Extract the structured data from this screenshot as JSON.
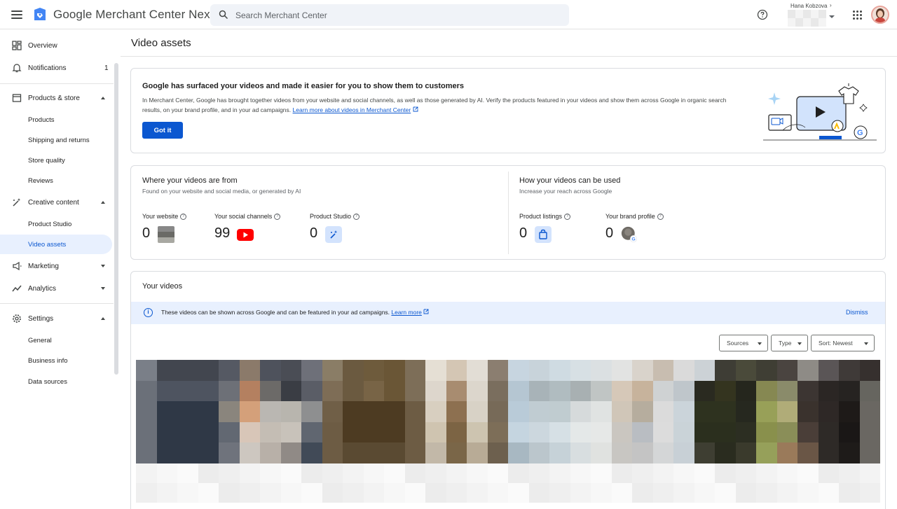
{
  "app": {
    "title": "Google Merchant Center Next"
  },
  "search": {
    "placeholder": "Search Merchant Center"
  },
  "account": {
    "name": "Hana Kobzova"
  },
  "sidebar": {
    "overview": "Overview",
    "notifications": {
      "label": "Notifications",
      "count": "1"
    },
    "products_store": {
      "label": "Products & store",
      "children": [
        "Products",
        "Shipping and returns",
        "Store quality",
        "Reviews"
      ]
    },
    "creative": {
      "label": "Creative content",
      "children": [
        "Product Studio",
        "Video assets"
      ]
    },
    "marketing": "Marketing",
    "analytics": "Analytics",
    "settings": {
      "label": "Settings",
      "children": [
        "General",
        "Business info",
        "Data sources"
      ]
    }
  },
  "page": {
    "title": "Video assets"
  },
  "banner": {
    "title": "Google has surfaced your videos and made it easier for you to show them to customers",
    "body": "In Merchant Center, Google has brought together videos from your website and social channels, as well as those generated by AI. Verify the products featured in your videos and show them across Google in organic search results, on your brand profile, and in your ad campaigns.",
    "link": "Learn more about videos in Merchant Center",
    "button": "Got it"
  },
  "sources": {
    "title": "Where your videos are from",
    "subtitle": "Found on your website and social media, or generated by AI",
    "metrics": [
      {
        "label": "Your website",
        "value": "0"
      },
      {
        "label": "Your social channels",
        "value": "99"
      },
      {
        "label": "Product Studio",
        "value": "0"
      }
    ]
  },
  "usage": {
    "title": "How your videos can be used",
    "subtitle": "Increase your reach across Google",
    "metrics": [
      {
        "label": "Product listings",
        "value": "0"
      },
      {
        "label": "Your brand profile",
        "value": "0"
      }
    ]
  },
  "videos": {
    "title": "Your videos",
    "info": "These videos can be shown across Google and can be featured in your ad campaigns.",
    "info_link": "Learn more",
    "dismiss": "Dismiss",
    "filters": {
      "sources": "Sources",
      "type": "Type",
      "sort": "Sort: Newest"
    }
  },
  "colors": {
    "accent": "#0b57d0",
    "youtube": "#ff0000",
    "info_bg": "#e8f0fe"
  }
}
